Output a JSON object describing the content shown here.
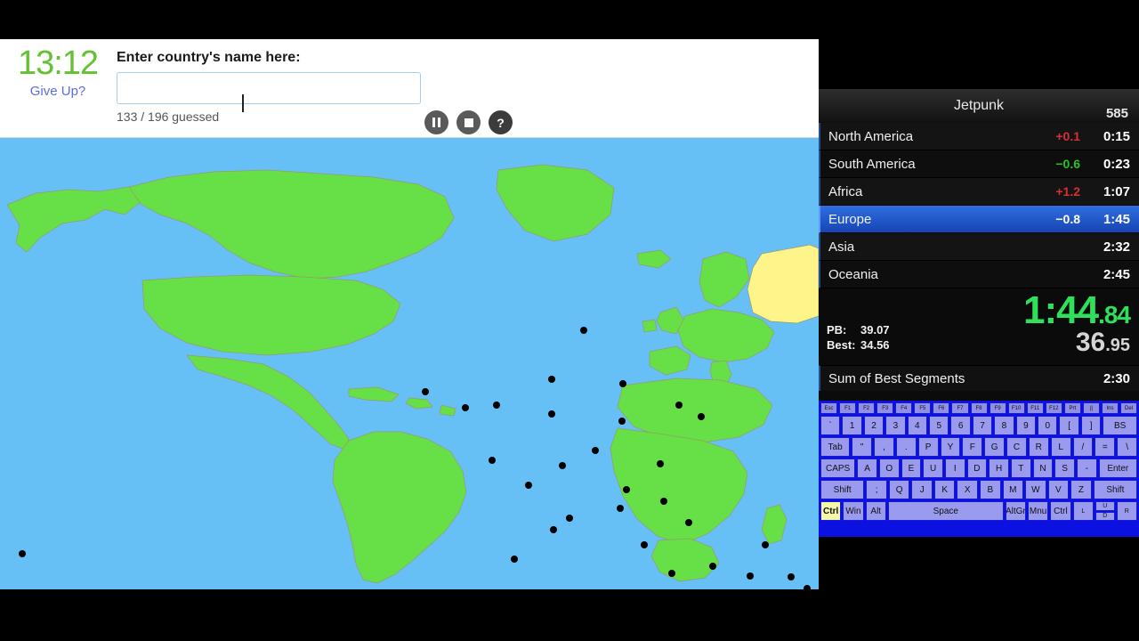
{
  "quiz": {
    "timer": "13:12",
    "give_up_label": "Give Up?",
    "entry_label": "Enter country's name here:",
    "input_value": "",
    "input_placeholder": "",
    "progress": "133 / 196 guessed",
    "buttons": {
      "pause": "pause-icon",
      "stop": "stop-icon",
      "help": "?"
    }
  },
  "livesplit": {
    "title": "Jetpunk",
    "attempts": "585",
    "splits": [
      {
        "name": "North America",
        "delta": "+0.1",
        "delta_state": "behind",
        "time": "0:15",
        "current": false
      },
      {
        "name": "South America",
        "delta": "−0.6",
        "delta_state": "ahead",
        "time": "0:23",
        "current": false
      },
      {
        "name": "Africa",
        "delta": "+1.2",
        "delta_state": "behind",
        "time": "1:07",
        "current": false
      },
      {
        "name": "Europe",
        "delta": "−0.8",
        "delta_state": "white",
        "time": "1:45",
        "current": true
      },
      {
        "name": "Asia",
        "delta": "",
        "delta_state": "white",
        "time": "2:32",
        "current": false
      },
      {
        "name": "Oceania",
        "delta": "",
        "delta_state": "white",
        "time": "2:45",
        "current": false
      }
    ],
    "main_timer": {
      "main": "1:44",
      "frac": ".84"
    },
    "segment_timer": {
      "main": "36",
      "frac": ".95"
    },
    "pb_label": "PB:",
    "pb_value": "39.07",
    "best_label": "Best:",
    "best_value": "34.56",
    "sob_label": "Sum of Best Segments",
    "sob_value": "2:30",
    "colors": {
      "ahead": "#23c423",
      "behind": "#d83030",
      "timer_green": "#2fe05a",
      "current_row": "#2f6fe0"
    }
  },
  "keyboard": {
    "layout_name": "Dvorak",
    "rows": [
      {
        "type": "fn",
        "keys": [
          {
            "label": "Esc"
          },
          {
            "label": "F1"
          },
          {
            "label": "F2"
          },
          {
            "label": "F3"
          },
          {
            "label": "F4"
          },
          {
            "label": "F5"
          },
          {
            "label": "F6"
          },
          {
            "label": "F7"
          },
          {
            "label": "F8"
          },
          {
            "label": "F9"
          },
          {
            "label": "F10"
          },
          {
            "label": "F11"
          },
          {
            "label": "F12"
          },
          {
            "label": "Prt"
          },
          {
            "label": "||"
          },
          {
            "label": "Ins"
          },
          {
            "label": "Del"
          }
        ]
      },
      {
        "type": "num",
        "keys": [
          {
            "label": "`"
          },
          {
            "label": "1"
          },
          {
            "label": "2"
          },
          {
            "label": "3"
          },
          {
            "label": "4"
          },
          {
            "label": "5"
          },
          {
            "label": "6"
          },
          {
            "label": "7"
          },
          {
            "label": "8"
          },
          {
            "label": "9"
          },
          {
            "label": "0"
          },
          {
            "label": "["
          },
          {
            "label": "]"
          },
          {
            "label": "BS",
            "w": "w18"
          }
        ]
      },
      {
        "type": "tab",
        "keys": [
          {
            "label": "Tab",
            "w": "w15"
          },
          {
            "label": "\""
          },
          {
            "label": ","
          },
          {
            "label": "."
          },
          {
            "label": "P"
          },
          {
            "label": "Y"
          },
          {
            "label": "F"
          },
          {
            "label": "G"
          },
          {
            "label": "C"
          },
          {
            "label": "R"
          },
          {
            "label": "L"
          },
          {
            "label": "/"
          },
          {
            "label": "="
          },
          {
            "label": "\\"
          }
        ]
      },
      {
        "type": "home",
        "keys": [
          {
            "label": "CAPS",
            "w": "w18"
          },
          {
            "label": "A"
          },
          {
            "label": "O"
          },
          {
            "label": "E"
          },
          {
            "label": "U"
          },
          {
            "label": "I"
          },
          {
            "label": "D"
          },
          {
            "label": "H"
          },
          {
            "label": "T"
          },
          {
            "label": "N"
          },
          {
            "label": "S"
          },
          {
            "label": "-"
          },
          {
            "label": "Enter",
            "w": "w20"
          }
        ]
      },
      {
        "type": "shift",
        "keys": [
          {
            "label": "Shift",
            "w": "w22"
          },
          {
            "label": ";"
          },
          {
            "label": "Q"
          },
          {
            "label": "J"
          },
          {
            "label": "K"
          },
          {
            "label": "X"
          },
          {
            "label": "B"
          },
          {
            "label": "M"
          },
          {
            "label": "W"
          },
          {
            "label": "V"
          },
          {
            "label": "Z"
          },
          {
            "label": "Shift",
            "w": "w22"
          }
        ]
      },
      {
        "type": "bottom",
        "keys": [
          {
            "label": "Ctrl",
            "active": true
          },
          {
            "label": "Win"
          },
          {
            "label": "Alt"
          },
          {
            "label": "Space",
            "w": "w60"
          },
          {
            "label": "AltGr"
          },
          {
            "label": "Mnu"
          },
          {
            "label": "Ctrl"
          }
        ]
      }
    ],
    "arrows": {
      "left": "L",
      "up": "U",
      "down": "D",
      "right": "R"
    }
  },
  "map": {
    "ocean_color": "#67c0f5",
    "guessed_color": "#66e046",
    "unguessed_color": "#fdf48a",
    "border_color": "#9a9a6a",
    "marker_color": "#000000"
  }
}
